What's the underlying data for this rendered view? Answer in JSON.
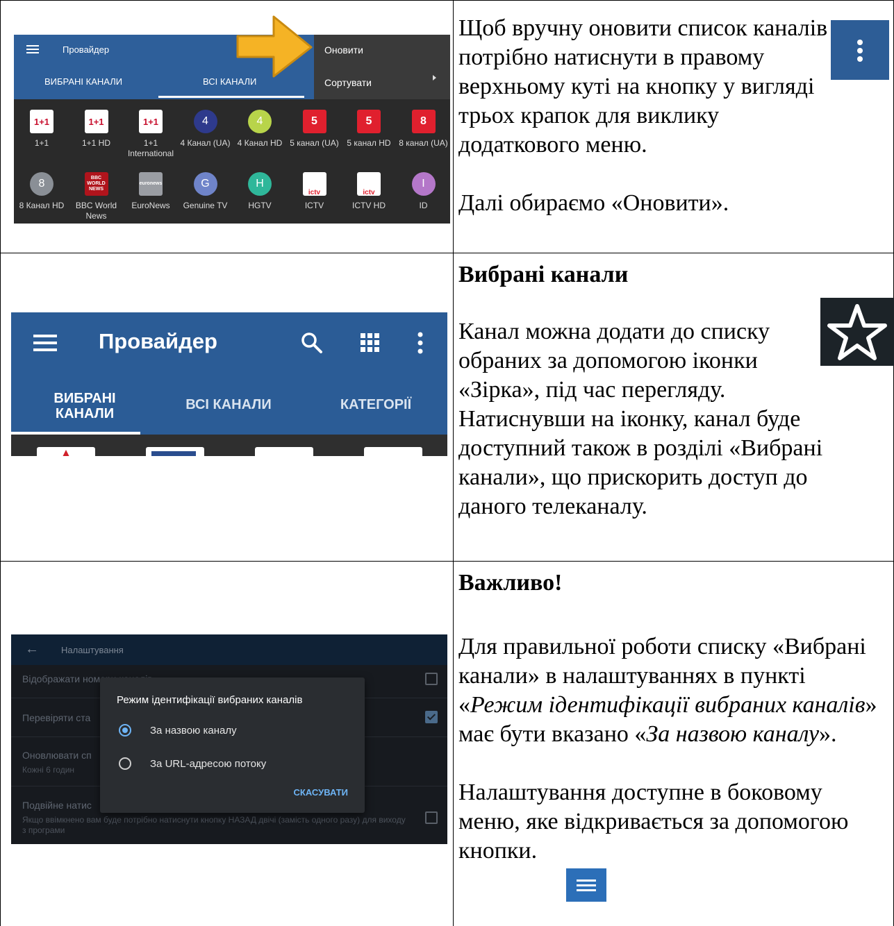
{
  "row1": {
    "screenshot": {
      "app_title": "Провайдер",
      "tabs": [
        "ВИБРАНІ КАНАЛИ",
        "ВСІ КАНАЛИ"
      ],
      "menu": [
        "Оновити",
        "Сортувати"
      ],
      "channels_row1": [
        {
          "logo": "1+1",
          "name": "1+1",
          "color": "#c8102e"
        },
        {
          "logo": "1+1",
          "name": "1+1 HD",
          "color": "#c8102e"
        },
        {
          "logo": "1+1",
          "name": "1+1 International",
          "color": "#c8102e"
        },
        {
          "logo": "4",
          "name": "4 Канал (UA)",
          "color": "#2e3a8c"
        },
        {
          "logo": "4",
          "name": "4 Канал HD",
          "color": "#b8d44a"
        },
        {
          "logo": "5",
          "name": "5 канал (UA)",
          "color": "#e0202e"
        },
        {
          "logo": "5",
          "name": "5 канал HD",
          "color": "#e0202e"
        },
        {
          "logo": "8",
          "name": "8 канал (UA)",
          "color": "#e0202e"
        }
      ],
      "channels_row2": [
        {
          "logo": "8",
          "name": "8 Канал HD",
          "color": "#8a8f96"
        },
        {
          "logo": "BBC WORLD NEWS",
          "name": "BBC World News",
          "color": "#b0141c"
        },
        {
          "logo": "euronews",
          "name": "EuroNews",
          "color": "#9a9da3"
        },
        {
          "logo": "G",
          "name": "Genuine TV",
          "color": "#6f84c9"
        },
        {
          "logo": "H",
          "name": "HGTV",
          "color": "#2fb79a"
        },
        {
          "logo": "ictv",
          "name": "ICTV",
          "color": "#ffffff"
        },
        {
          "logo": "ictv",
          "name": "ICTV HD",
          "color": "#ffffff"
        },
        {
          "logo": "I",
          "name": "ID",
          "color": "#b477c9"
        }
      ]
    },
    "text": {
      "p1": "Щоб вручну оновити список каналів потрібно натиснути в правому верхньому куті на кнопку у вигляді трьох крапок для виклику додаткового меню.",
      "p2": "Далі обираємо «Оновити»."
    }
  },
  "row2": {
    "screenshot": {
      "app_title": "Провайдер",
      "tabs": [
        "ВИБРАНІ КАНАЛИ",
        "ВСІ КАНАЛИ",
        "КАТЕГОРІЇ"
      ]
    },
    "text": {
      "heading": "Вибрані канали",
      "p1": "Канал можна додати до списку обраних за допомогою іконки «Зірка», під час перегляду. Натиснувши на іконку, канал буде доступний також в розділі «Вибрані канали», що прискорить доступ до даного телеканалу."
    }
  },
  "row3": {
    "screenshot": {
      "title": "Налаштування",
      "rows": [
        "Відображати номери каналів",
        "Перевіряти ста",
        "Оновлювати сп",
        "Подвійне натис"
      ],
      "row3_sub": "Кожні 6 годин",
      "row4_sub": "Якщо ввімкнено вам буде потрібно натиснути кнопку НАЗАД двічі (замість одного разу) для виходу з програми",
      "dialog_title": "Режим ідентифікації вибраних каналів",
      "options": [
        "За назвою каналу",
        "За URL-адресою потоку"
      ],
      "cancel": "СКАСУВАТИ"
    },
    "text": {
      "heading": "Важливо!",
      "p1_a": "Для правильної роботи списку «Вибрані канали» в налаштуваннях в пункті «",
      "p1_em1": "Режим ідентифікації вибраних каналів",
      "p1_b": "» має бути вказано «",
      "p1_em2": "За назвою каналу",
      "p1_c": "».",
      "p2": "Налаштування доступне в боковому меню, яке відкривається за допомогою кнопки."
    }
  }
}
